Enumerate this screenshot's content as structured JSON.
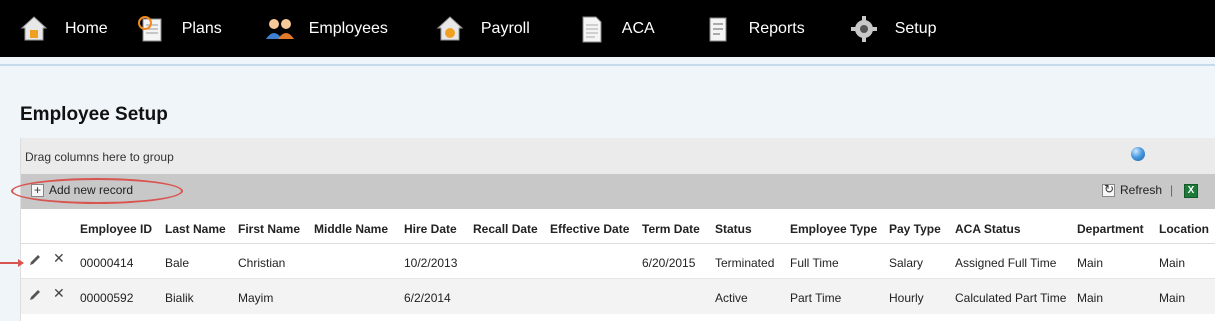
{
  "nav": {
    "items": [
      {
        "label": "Home",
        "icon": "home-icon"
      },
      {
        "label": "Plans",
        "icon": "plans-icon"
      },
      {
        "label": "Employees",
        "icon": "employees-icon"
      },
      {
        "label": "Payroll",
        "icon": "payroll-icon"
      },
      {
        "label": "ACA",
        "icon": "aca-document-icon"
      },
      {
        "label": "Reports",
        "icon": "reports-icon"
      },
      {
        "label": "Setup",
        "icon": "gear-icon"
      }
    ]
  },
  "page": {
    "title": "Employee Setup"
  },
  "grid": {
    "group_hint": "Drag columns here to group",
    "toolbar": {
      "add_label": "Add new record",
      "refresh_label": "Refresh",
      "separator": "|",
      "excel_glyph": "X"
    },
    "columns": [
      "Employee ID",
      "Last Name",
      "First Name",
      "Middle Name",
      "Hire Date",
      "Recall Date",
      "Effective Date",
      "Term Date",
      "Status",
      "Employee Type",
      "Pay Type",
      "ACA Status",
      "Department",
      "Location"
    ],
    "rows": [
      [
        "00000414",
        "Bale",
        "Christian",
        "",
        "10/2/2013",
        "",
        "",
        "6/20/2015",
        "Terminated",
        "Full Time",
        "Salary",
        "Assigned Full Time",
        "Main",
        "Main"
      ],
      [
        "00000592",
        "Bialik",
        "Mayim",
        "",
        "6/2/2014",
        "",
        "",
        "",
        "Active",
        "Part Time",
        "Hourly",
        "Calculated Part Time",
        "Main",
        "Main"
      ]
    ],
    "row_action_icons": [
      "edit-pencil-icon",
      "delete-x-icon"
    ]
  },
  "colors": {
    "nav_bg": "#000000",
    "main_bg": "#f0f5fa",
    "toolbar_bg": "#c8c8c8",
    "annotation": "#d9534f",
    "excel_green": "#1e7a3a"
  }
}
